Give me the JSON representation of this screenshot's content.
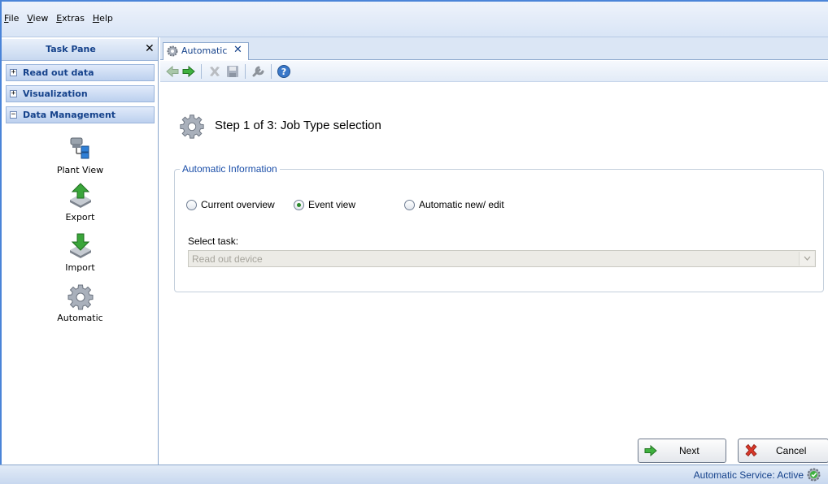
{
  "menu": [
    {
      "label": "File",
      "mnemonic": "F",
      "rest": "ile"
    },
    {
      "label": "View",
      "mnemonic": "V",
      "rest": "iew"
    },
    {
      "label": "Extras",
      "mnemonic": "E",
      "rest": "xtras"
    },
    {
      "label": "Help",
      "mnemonic": "H",
      "rest": "elp"
    }
  ],
  "task_pane": {
    "title": "Task Pane",
    "close_glyph": "✕",
    "sections": [
      {
        "label": "Read out data",
        "toggle": "+"
      },
      {
        "label": "Visualization",
        "toggle": "+"
      },
      {
        "label": "Data Management",
        "toggle": "−"
      }
    ],
    "items": [
      {
        "label": "Plant View",
        "icon": "plant-view-icon"
      },
      {
        "label": "Export",
        "icon": "export-icon"
      },
      {
        "label": "Import",
        "icon": "import-icon"
      },
      {
        "label": "Automatic",
        "icon": "gear-icon"
      }
    ]
  },
  "tab": {
    "label": "Automatic",
    "close_glyph": "✕"
  },
  "toolbar": [
    "back-arrow-icon",
    "forward-arrow-icon",
    "delete-icon",
    "save-icon",
    "wrench-icon",
    "help-icon"
  ],
  "step_title": "Step 1 of 3: Job Type selection",
  "group": {
    "legend": "Automatic Information",
    "radios": [
      {
        "label": "Current overview",
        "checked": false
      },
      {
        "label": "Event view",
        "checked": true
      },
      {
        "label": "Automatic new/ edit",
        "checked": false
      }
    ],
    "select_label": "Select task:",
    "select_value": "Read out device",
    "select_enabled": false
  },
  "buttons": {
    "next": "Next",
    "cancel": "Cancel"
  },
  "status": {
    "text": "Automatic Service: Active"
  },
  "colors": {
    "accent": "#15428b",
    "frame": "#4a84d8",
    "legend": "#1a4ea8"
  }
}
